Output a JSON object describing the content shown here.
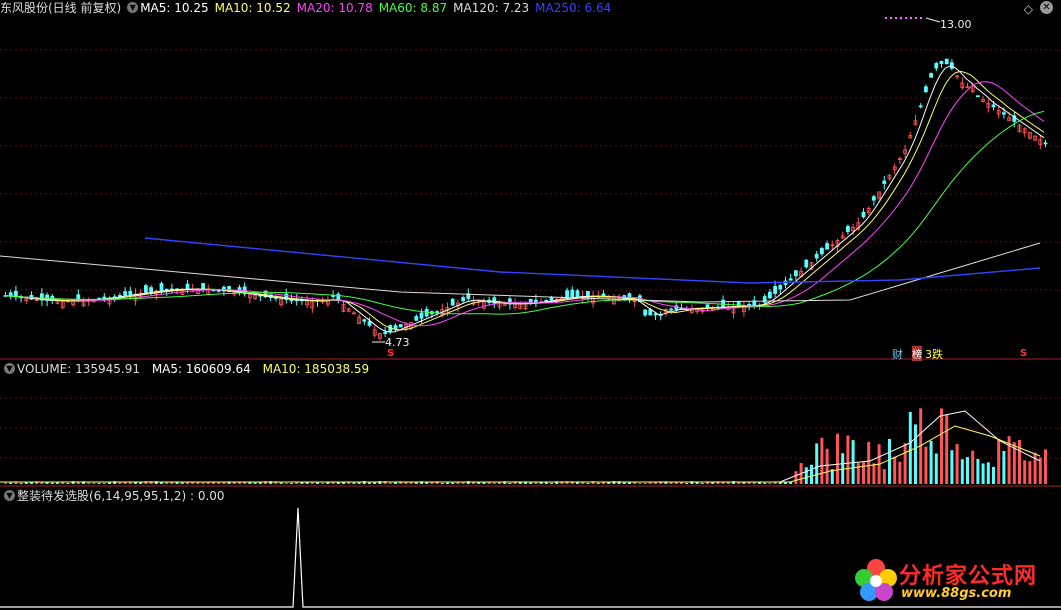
{
  "price_panel": {
    "title": "东风股份(日线 前复权)",
    "ma_items": [
      {
        "label": "MA5: 10.25",
        "color": "#ffffff"
      },
      {
        "label": "MA10: 10.52",
        "color": "#ffff66"
      },
      {
        "label": "MA20: 10.78",
        "color": "#ff44ff"
      },
      {
        "label": "MA60: 8.87",
        "color": "#44ff44"
      },
      {
        "label": "MA120: 7.23",
        "color": "#dddddd"
      },
      {
        "label": "MA250: 6.64",
        "color": "#3344ff"
      }
    ],
    "high_label": "13.00",
    "low_label": "4.73",
    "event_s1": "S",
    "event_s2": "S",
    "event_cai": "财",
    "event_bang": "榜",
    "event_sanzhang": "3跌"
  },
  "volume_panel": {
    "vol_label": "VOLUME: 135945.91",
    "ma5_label": "MA5: 160609.64",
    "ma10_label": "MA10: 185038.59"
  },
  "indicator_panel": {
    "label": "整装待发选股(6,14,95,95,1,2) : 0.00"
  },
  "watermark": {
    "title": "分析家公式网",
    "url": "www.88gs.com"
  },
  "colors": {
    "up": "#ff5555",
    "down": "#55ffff",
    "ma250": "#3344ff"
  }
}
